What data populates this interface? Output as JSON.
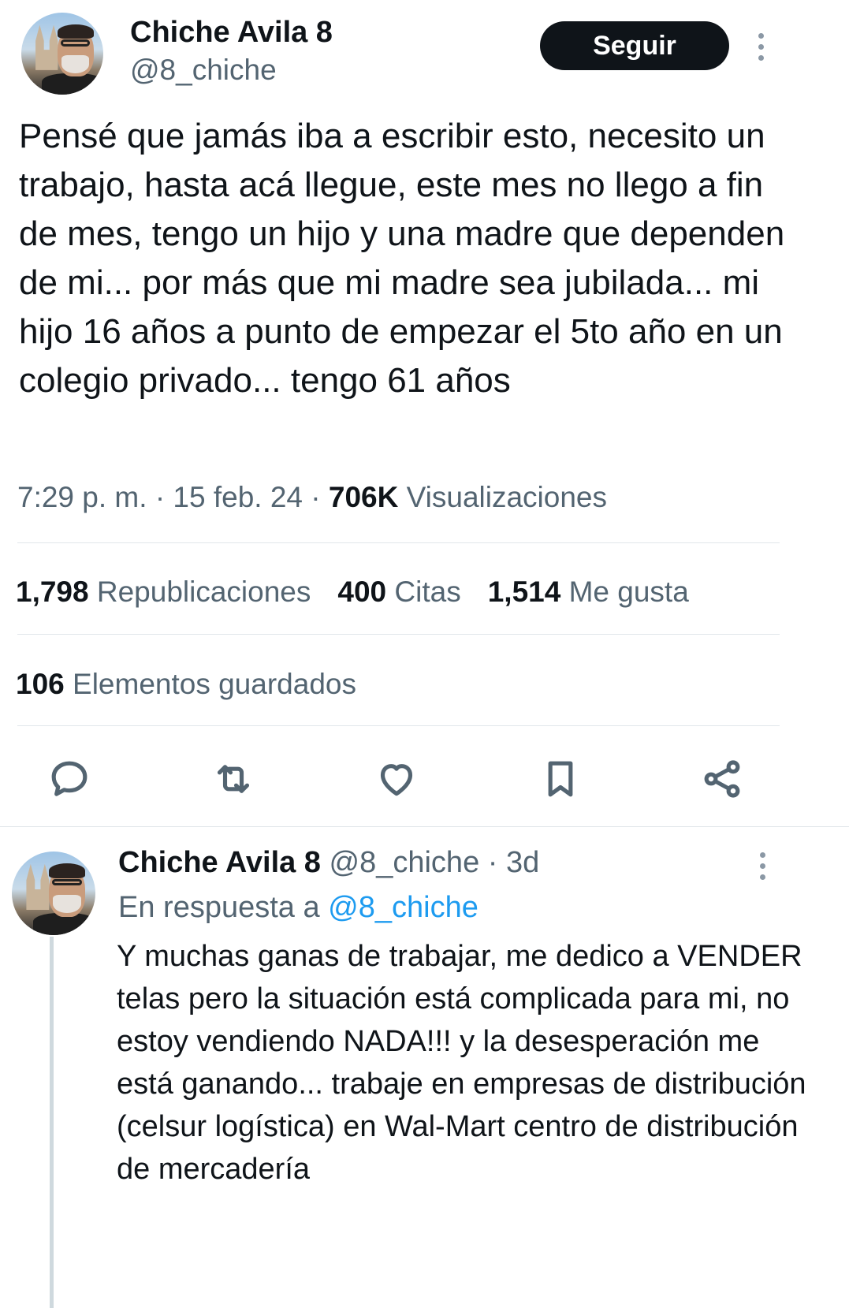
{
  "tweet": {
    "author_name": "Chiche Avila 8",
    "author_handle": "@8_chiche",
    "follow_label": "Seguir",
    "text": "Pensé que jamás iba a escribir esto, necesito un trabajo, hasta acá llegue, este mes no llego a fin de mes, tengo un hijo y una madre que dependen de mi... por más que mi madre sea jubilada... mi hijo 16 años a punto de empezar el 5to año en un colegio privado... tengo 61 años",
    "time": "7:29 p. m.",
    "date": "15 feb. 24",
    "views_count": "706K",
    "views_label": "Visualizaciones",
    "separator": "·",
    "stats": {
      "reposts_count": "1,798",
      "reposts_label": "Republicaciones",
      "quotes_count": "400",
      "quotes_label": "Citas",
      "likes_count": "1,514",
      "likes_label": "Me gusta",
      "bookmarks_count": "106",
      "bookmarks_label": "Elementos guardados"
    },
    "actions": [
      "reply-icon",
      "repost-icon",
      "like-icon",
      "bookmark-icon",
      "share-icon"
    ]
  },
  "reply": {
    "author_name": "Chiche Avila 8",
    "author_handle": "@8_chiche",
    "separator": "·",
    "age": "3d",
    "in_reply_prefix": "En respuesta a",
    "in_reply_handle": "@8_chiche",
    "text": "Y muchas ganas de trabajar, me dedico a VENDER telas pero la situación está complicada para mi, no estoy vendiendo NADA!!! y la desesperación me está ganando... trabaje en empresas de distribución (celsur logística) en Wal-Mart centro de distribución de mercadería"
  },
  "colors": {
    "text": "#0f1419",
    "muted": "#536471",
    "link": "#1d9bf0",
    "button_bg": "#0f1419",
    "divider": "#e1e6ea"
  }
}
